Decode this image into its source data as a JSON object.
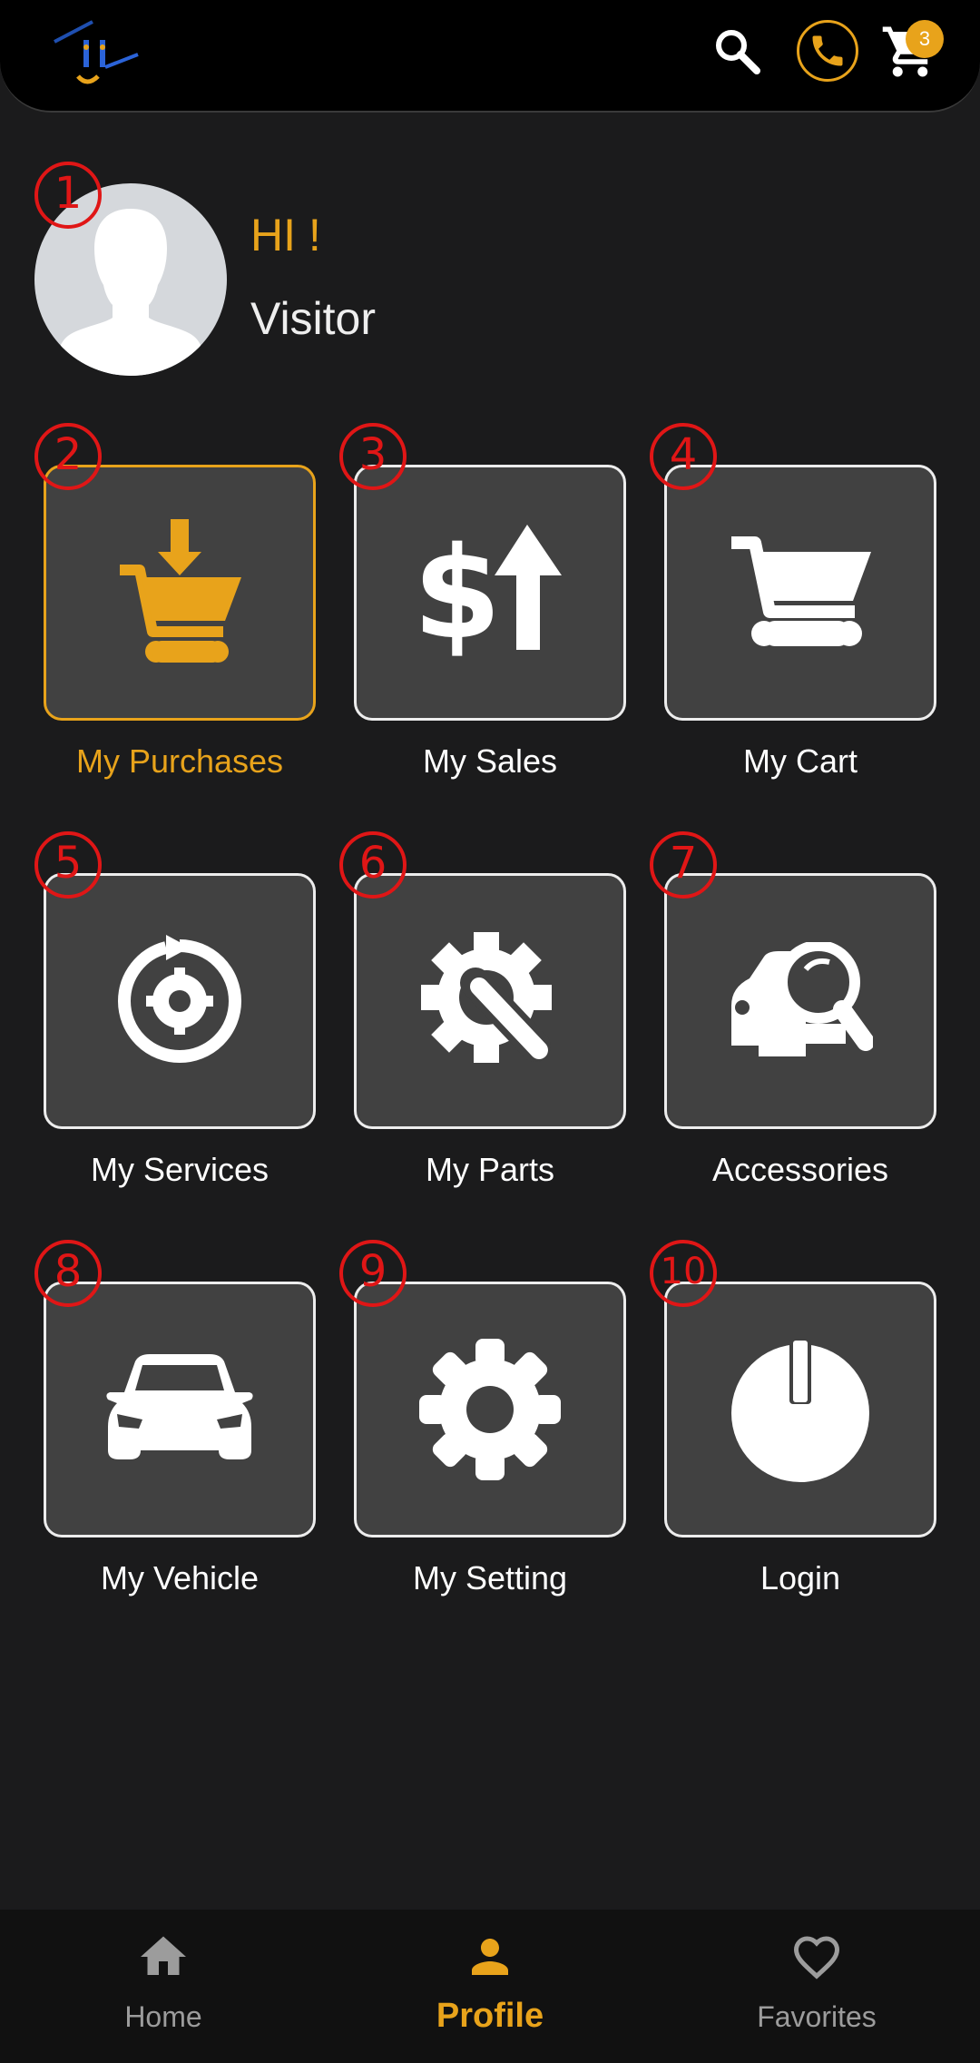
{
  "header": {
    "logo_icon": "app-logo",
    "search_icon": "search-icon",
    "phone_icon": "phone-icon",
    "cart_icon": "cart-icon",
    "cart_count": "3"
  },
  "markers": [
    "1",
    "2",
    "3",
    "4",
    "5",
    "6",
    "7",
    "8",
    "9",
    "10"
  ],
  "profile": {
    "greeting": "HI !",
    "name": "Visitor"
  },
  "menu": [
    {
      "label": "My Purchases",
      "icon": "purchase-cart-icon",
      "active": true
    },
    {
      "label": "My Sales",
      "icon": "dollar-up-icon"
    },
    {
      "label": "My Cart",
      "icon": "cart-icon"
    },
    {
      "label": "My Services",
      "icon": "gear-cycle-icon"
    },
    {
      "label": "My Parts",
      "icon": "gear-wrench-icon"
    },
    {
      "label": "Accessories",
      "icon": "car-search-icon"
    },
    {
      "label": "My Vehicle",
      "icon": "car-icon"
    },
    {
      "label": "My Setting",
      "icon": "gear-icon"
    },
    {
      "label": "Login",
      "icon": "power-icon"
    }
  ],
  "nav": {
    "home": "Home",
    "profile": "Profile",
    "favorites": "Favorites"
  },
  "colors": {
    "accent": "#e8a31b",
    "marker": "#e01616",
    "background": "#1b1b1c",
    "tile": "#414141"
  }
}
